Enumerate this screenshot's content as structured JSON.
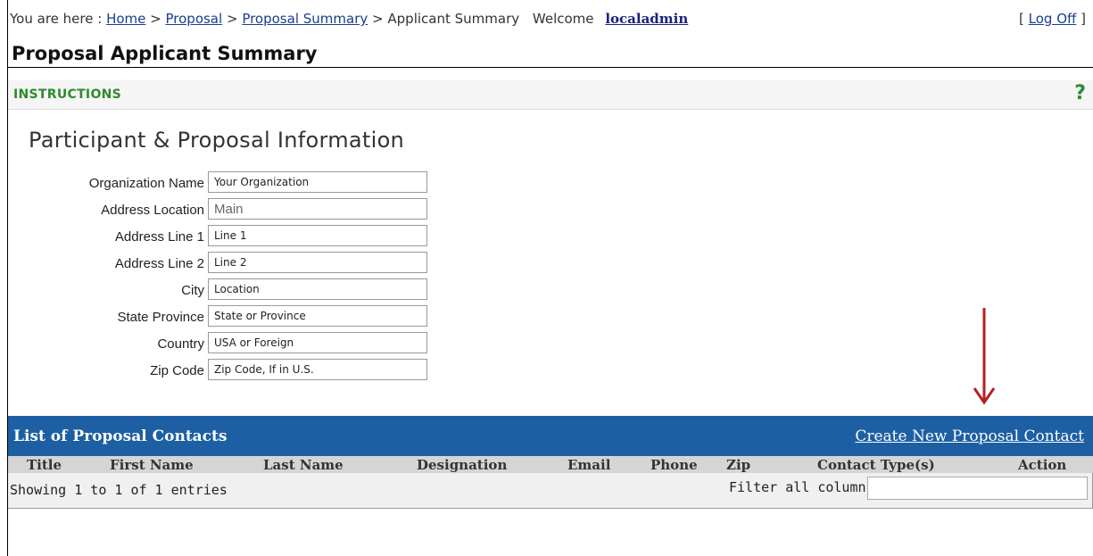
{
  "breadcrumb": {
    "prefix": "You are here :",
    "items": [
      "Home",
      "Proposal",
      "Proposal Summary"
    ],
    "separator": ">",
    "current": "Applicant Summary",
    "welcome": "Welcome",
    "user": "localadmin"
  },
  "logoff": {
    "open": "[",
    "label": "Log Off",
    "close": "]"
  },
  "page_title": "Proposal Applicant Summary",
  "instructions": {
    "label": "INSTRUCTIONS",
    "help": "?"
  },
  "section_title": "Participant & Proposal Information",
  "form": {
    "organization_name": {
      "label": "Organization Name",
      "value": "Your Organization"
    },
    "address_location": {
      "label": "Address Location",
      "value": "Main"
    },
    "address_line_1": {
      "label": "Address Line 1",
      "value": "Line 1"
    },
    "address_line_2": {
      "label": "Address Line 2",
      "value": "Line 2"
    },
    "city": {
      "label": "City",
      "value": "Location"
    },
    "state_province": {
      "label": "State Province",
      "value": "State or Province"
    },
    "country": {
      "label": "Country",
      "value": "USA or Foreign"
    },
    "zip_code": {
      "label": "Zip Code",
      "value": "Zip Code, If in U.S."
    }
  },
  "contacts": {
    "title": "List of Proposal Contacts",
    "create_link": "Create New Proposal Contact",
    "columns": [
      "Title",
      "First Name",
      "Last Name",
      "Designation",
      "Email",
      "Phone",
      "Zip",
      "Contact Type(s)",
      "Action"
    ],
    "info": "Showing 1 to 1 of 1 entries",
    "filter_label": "Filter all columns:",
    "filter_value": ""
  },
  "colors": {
    "header_blue": "#1d5fa3",
    "instructions_green": "#2e8b2e",
    "arrow_red": "#b22222"
  },
  "icons": {
    "help": "question-mark-icon",
    "arrow": "down-arrow-icon"
  }
}
